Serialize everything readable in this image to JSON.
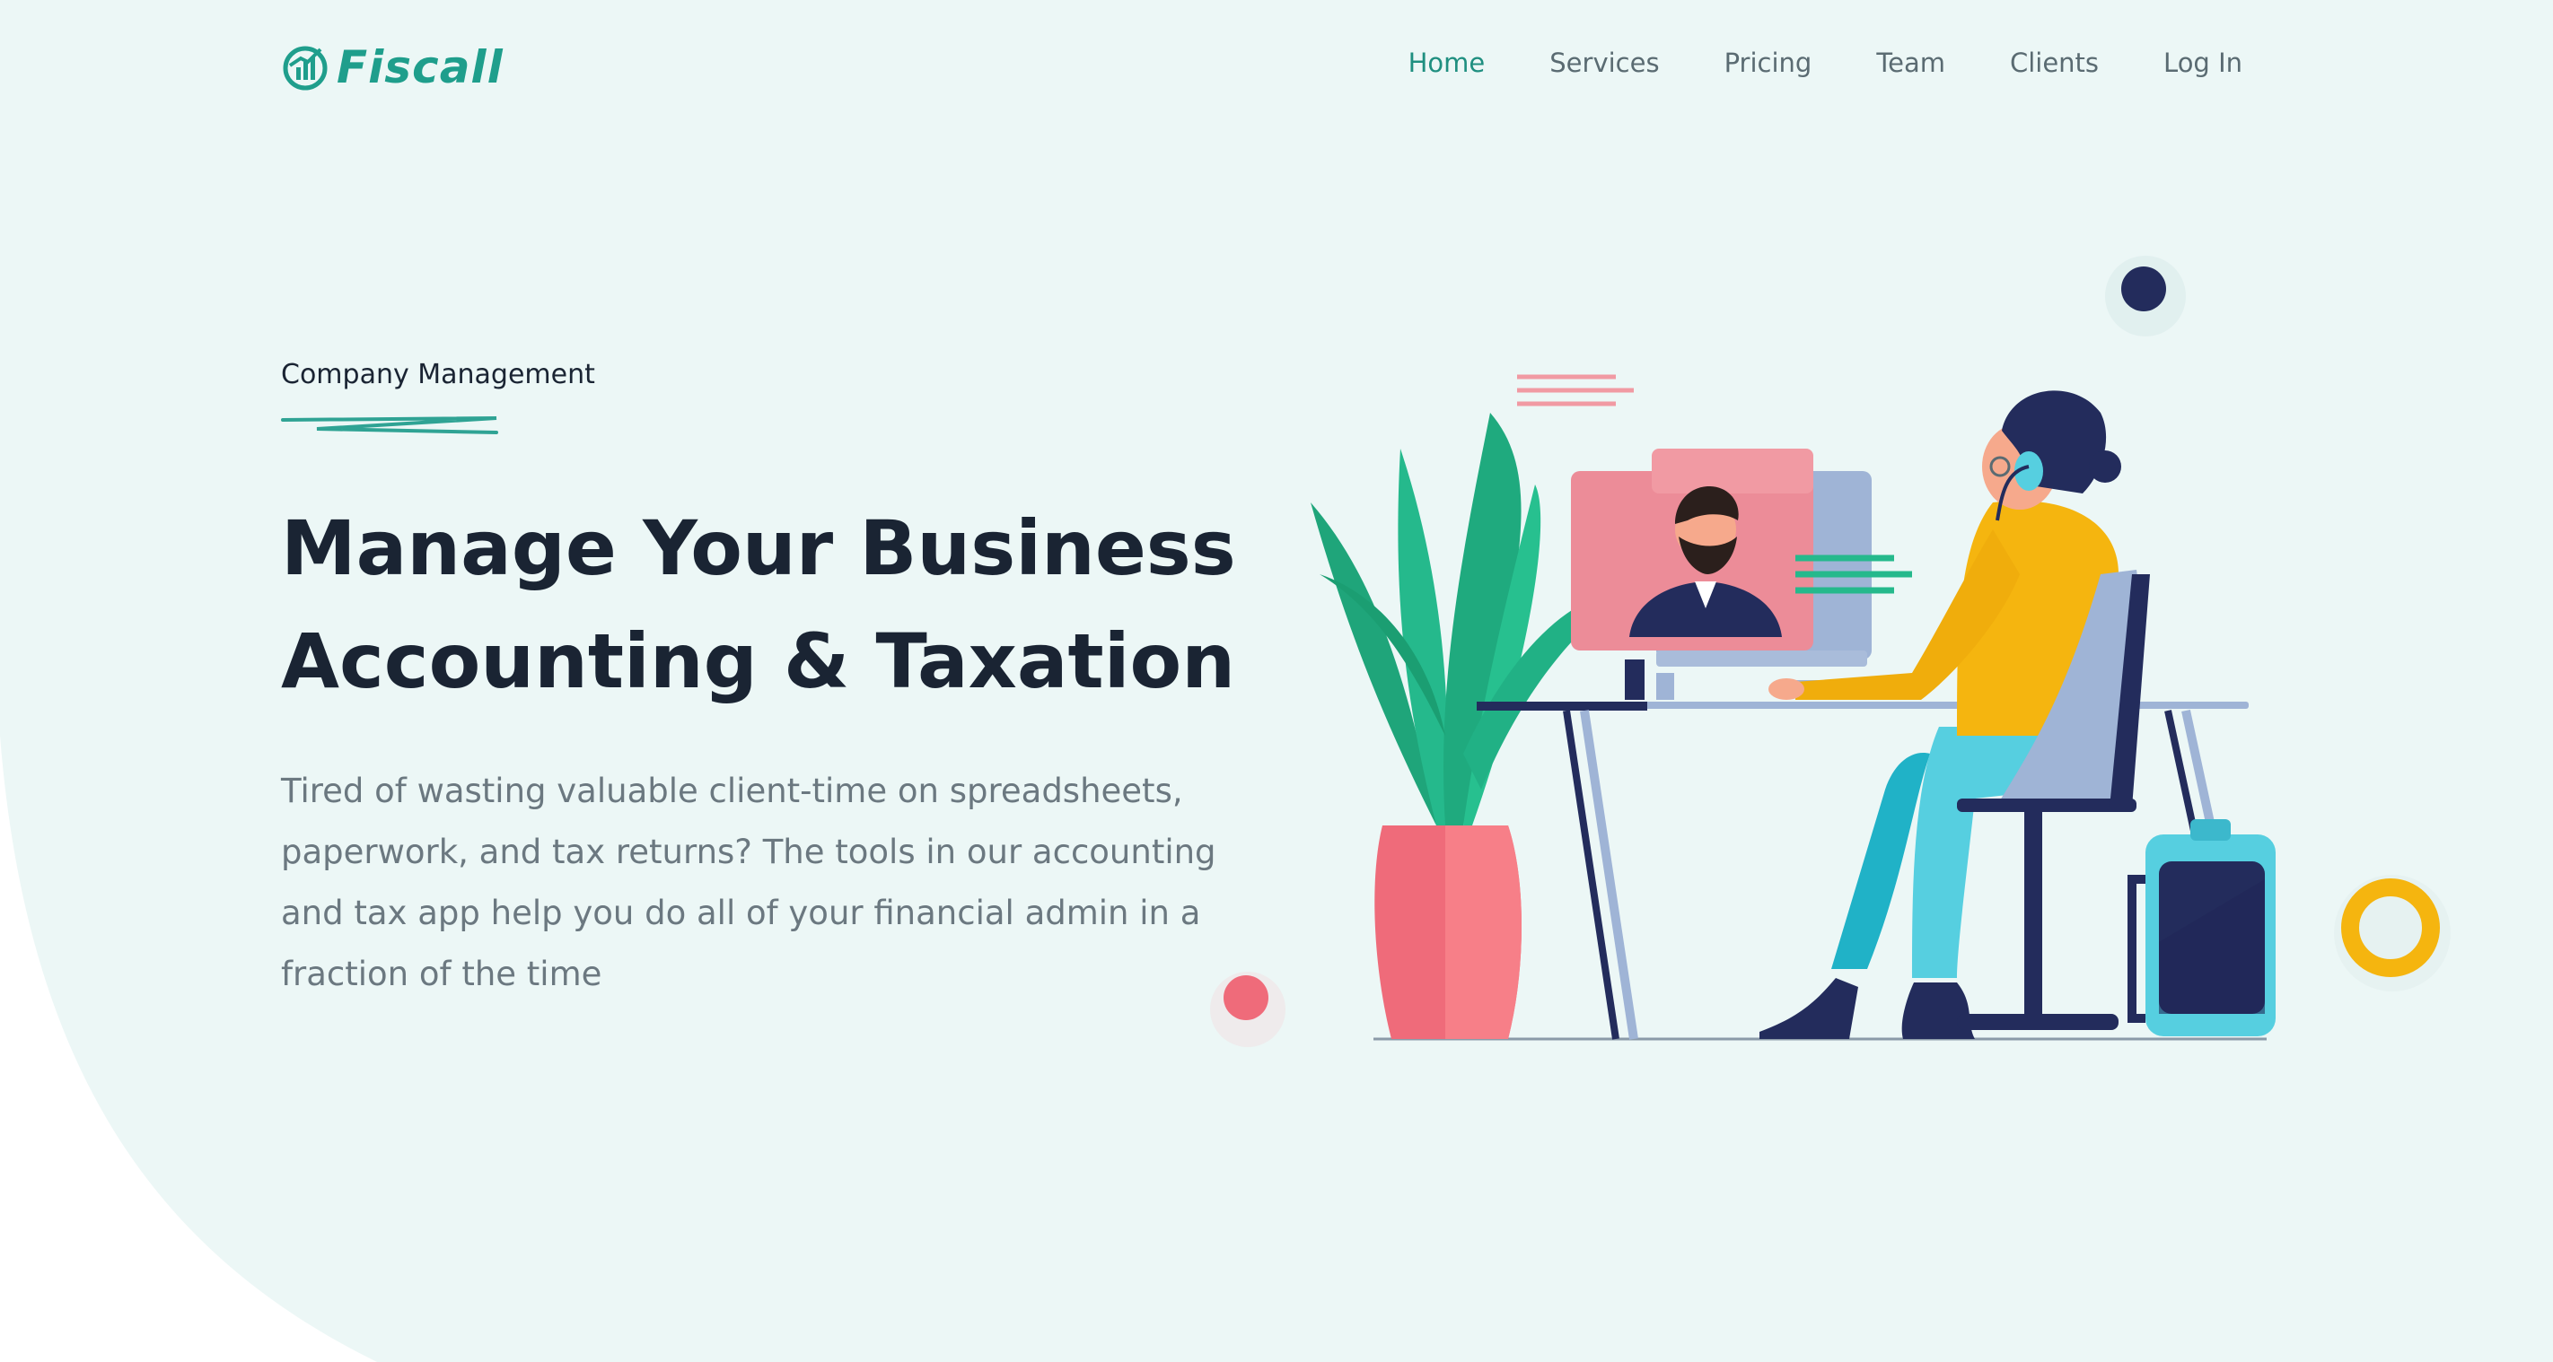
{
  "brand": {
    "logo_text": "Fiscall",
    "logo_icon": "chart-circle-icon",
    "accent": "#1f9e8c"
  },
  "nav": {
    "items": [
      {
        "label": "Home",
        "active": true
      },
      {
        "label": "Services",
        "active": false
      },
      {
        "label": "Pricing",
        "active": false
      },
      {
        "label": "Team",
        "active": false
      },
      {
        "label": "Clients",
        "active": false
      },
      {
        "label": "Log In",
        "active": false
      }
    ]
  },
  "hero": {
    "eyebrow": "Company Management",
    "title_line1": "Manage Your Business",
    "title_line2": "Accounting & Taxation",
    "description": "Tired of wasting valuable client-time on spreadsheets, paperwork, and tax returns? The tools in our accounting and tax app help you do all of your financial admin in a fraction of the time"
  },
  "colors": {
    "background": "#ecf7f6",
    "heading": "#1a2433",
    "body_text": "#6b7880",
    "nav_active": "#1f8f80",
    "navy": "#232c5c",
    "coral": "#ef6b7a",
    "yellow": "#f5b50f",
    "teal": "#25b98c"
  },
  "illustration": {
    "subject": "person-at-desk-video-call-illustration"
  }
}
